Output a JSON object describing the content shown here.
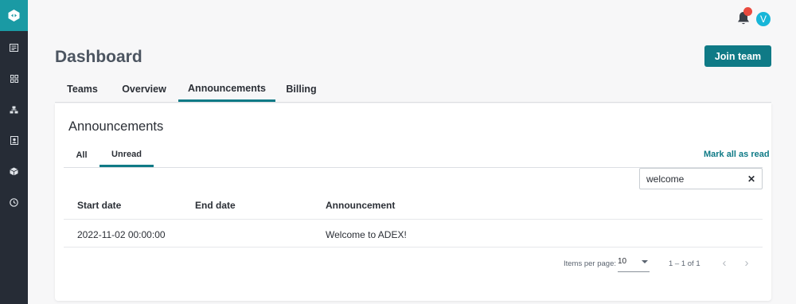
{
  "sidebar": {
    "logo_icon": "logo-icon",
    "items": [
      {
        "icon": "newspaper-icon"
      },
      {
        "icon": "grid-icon"
      },
      {
        "icon": "hierarchy-icon"
      },
      {
        "icon": "contact-card-icon"
      },
      {
        "icon": "cube-icon"
      },
      {
        "icon": "clock-icon"
      }
    ]
  },
  "topbar": {
    "avatar_initial": "V",
    "bell_icon": "bell-icon"
  },
  "header": {
    "title": "Dashboard",
    "join_label": "Join team"
  },
  "main_tabs": [
    "Teams",
    "Overview",
    "Announcements",
    "Billing"
  ],
  "main_tabs_active": "Announcements",
  "card": {
    "title": "Announcements",
    "sub_tabs": [
      "All",
      "Unread"
    ],
    "sub_tabs_active": "Unread",
    "mark_all_label": "Mark all as read",
    "search_value": "welcome",
    "table": {
      "columns": [
        "Start date",
        "End date",
        "Announcement"
      ],
      "rows": [
        {
          "start": "2022-11-02 00:00:00",
          "end": "",
          "announcement": "Welcome to ADEX!"
        }
      ]
    },
    "pagination": {
      "items_per_page_label": "Items per page:",
      "items_per_page": "10",
      "range": "1 – 1 of 1"
    }
  },
  "colors": {
    "accent": "#0f7a86",
    "sidebar": "#262c36",
    "logo_bg": "#1a9aa4",
    "notification_dot": "#e94a3f",
    "avatar": "#18b6d8"
  }
}
